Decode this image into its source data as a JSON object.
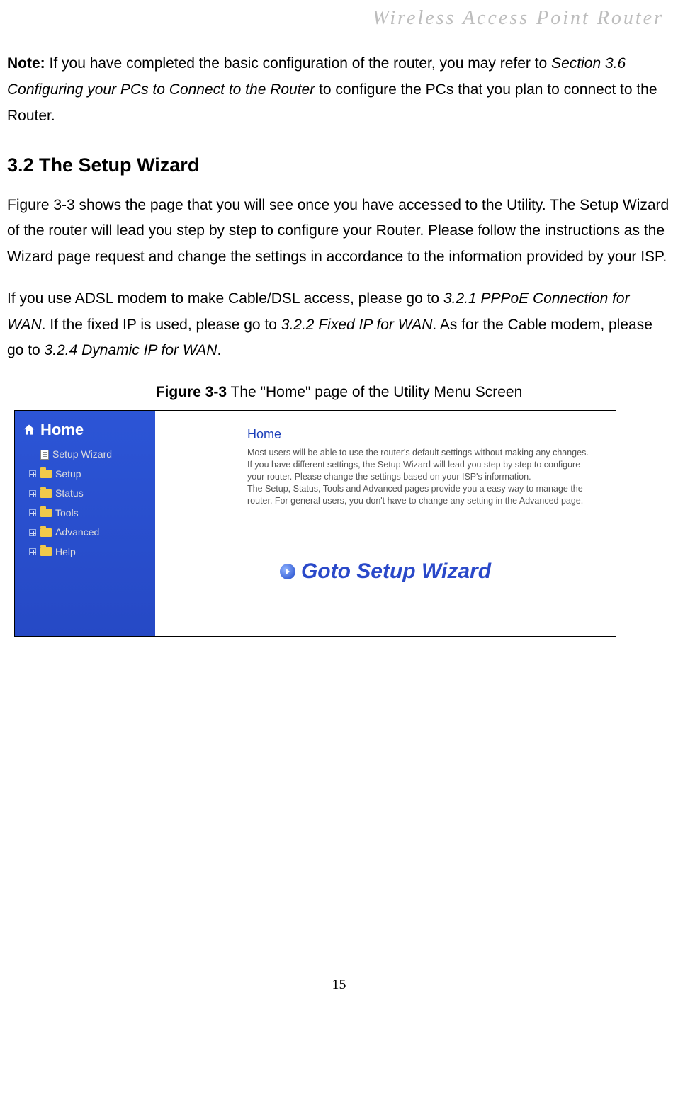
{
  "header": "Wireless  Access  Point  Router",
  "note": {
    "label": "Note:",
    "part1": " If you have completed the basic configuration of the router, you may refer to ",
    "ref": "Section 3.6 Configuring your PCs to Connect to the Router",
    "part2": " to configure the PCs that you plan to connect to the Router."
  },
  "section_heading": "3.2 The Setup Wizard",
  "para1": "Figure 3-3 shows the page that you will see once you have accessed to the Utility. The Setup Wizard of the router will lead you step by step to configure your Router. Please follow the instructions as the Wizard page request and change the settings in accordance to the information provided by your ISP.",
  "para2": {
    "t1": "If you use ADSL modem to make Cable/DSL access, please go to ",
    "r1": "3.2.1 PPPoE Connection for WAN",
    "t2": ". If the fixed IP is used, please go to ",
    "r2": "3.2.2 Fixed IP for WAN",
    "t3": ". As for the Cable modem, please go to ",
    "r3": "3.2.4 Dynamic IP for WAN",
    "t4": "."
  },
  "figure": {
    "label": "Figure 3-3",
    "caption": " The \"Home\" page of the Utility Menu Screen"
  },
  "screenshot": {
    "sidebar": {
      "home": "Home",
      "items": [
        "Setup Wizard",
        "Setup",
        "Status",
        "Tools",
        "Advanced",
        "Help"
      ]
    },
    "panel": {
      "heading": "Home",
      "line1": "Most users will be able to use the router's default settings without making any changes. If you have different settings, the Setup Wizard will lead you step by step to configure your router. Please change the settings based on your ISP's information.",
      "line2": "The Setup, Status, Tools and Advanced pages provide you a easy way to manage the router. For general users, you don't have to change any setting in the Advanced page.",
      "goto": "Goto Setup Wizard"
    }
  },
  "page_number": "15"
}
